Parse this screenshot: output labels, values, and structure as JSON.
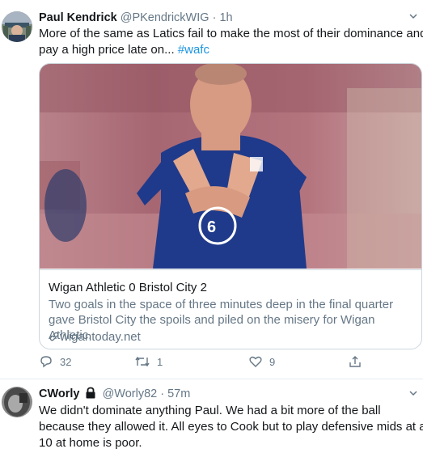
{
  "tweet1": {
    "name": "Paul Kendrick",
    "handle": "@PKendrickWIG",
    "sep": "·",
    "time": "1h",
    "text_main": "More of the same as Latics fail to make the most of their dominance and pay a high price late on...",
    "hashtag": "#wafc",
    "card": {
      "title": "Wigan Athletic 0 Bristol City 2",
      "description": "Two goals in the space of three minutes deep in the final quarter gave Bristol City the spoils and piled on the misery for Wigan Athletic.",
      "link": "wigantoday.net",
      "link_icon": "link-icon"
    },
    "actions": {
      "replies": "32",
      "retweets": "1",
      "likes": "9"
    }
  },
  "tweet2": {
    "name": "CWorly",
    "handle": "@Worly82",
    "sep": "·",
    "time": "57m",
    "text": "We didn't dominate anything Paul. We had a bit more of the ball because they allowed it. All eyes to Cook but to play defensive mids at a 10 at home is poor."
  },
  "icons": {
    "reply": "reply-icon",
    "retweet": "retweet-icon",
    "like": "heart-icon",
    "share": "share-icon",
    "lock": "lock-icon",
    "caret": "chevron-down-icon"
  },
  "colors": {
    "link": "#1b95e0",
    "secondary": "#657786",
    "border": "#ccd6dd"
  }
}
